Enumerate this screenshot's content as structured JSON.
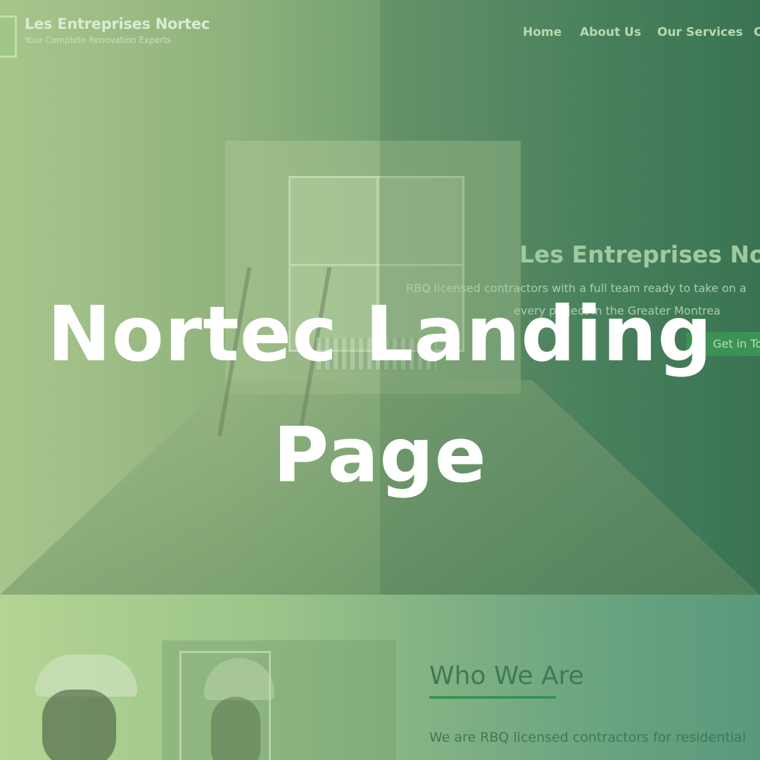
{
  "brand": {
    "name": "Les Entreprises Nortec",
    "tagline": "Your Complete Renovation Experts"
  },
  "nav": {
    "items": [
      {
        "label": "Home"
      },
      {
        "label": "About Us"
      },
      {
        "label": "Our Services"
      },
      {
        "label": "C"
      }
    ]
  },
  "hero": {
    "title": "Les Entreprises Nor",
    "text_line1": "RBQ licensed contractors with a full team ready to take on a",
    "text_line2": "every project in the Greater Montrea",
    "cta_label": "Get in To"
  },
  "about": {
    "heading": "Who We Are",
    "text": "We are RBQ licensed contractors for residential"
  },
  "overlay": {
    "title_line1": "Nortec Landing",
    "title_line2": "Page"
  },
  "colors": {
    "accent_green": "#3b9254",
    "overlay_text": "#ffffff"
  }
}
